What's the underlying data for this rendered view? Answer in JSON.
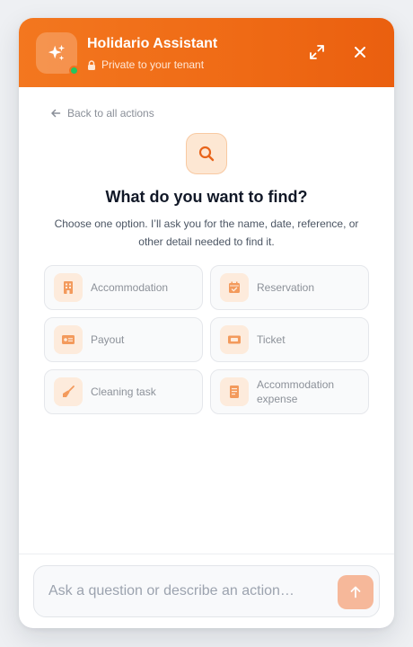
{
  "header": {
    "title": "Holidario Assistant",
    "subtitle": "Private to your tenant"
  },
  "back_link": "Back to all actions",
  "heading": "What do you want to find?",
  "description": "Choose one option. I’ll ask you for the name, date, reference, or other detail needed to find it.",
  "options": [
    {
      "label": "Accommodation",
      "icon": "building-icon"
    },
    {
      "label": "Reservation",
      "icon": "calendar-check-icon"
    },
    {
      "label": "Payout",
      "icon": "id-card-icon"
    },
    {
      "label": "Ticket",
      "icon": "ticket-icon"
    },
    {
      "label": "Cleaning task",
      "icon": "broom-icon"
    },
    {
      "label": "Accommodation expense",
      "icon": "receipt-icon"
    }
  ],
  "composer": {
    "placeholder": "Ask a question or describe an action…"
  },
  "colors": {
    "brand": "#F07020",
    "status_online": "#22C55E",
    "send_button": "#F6B89A"
  }
}
